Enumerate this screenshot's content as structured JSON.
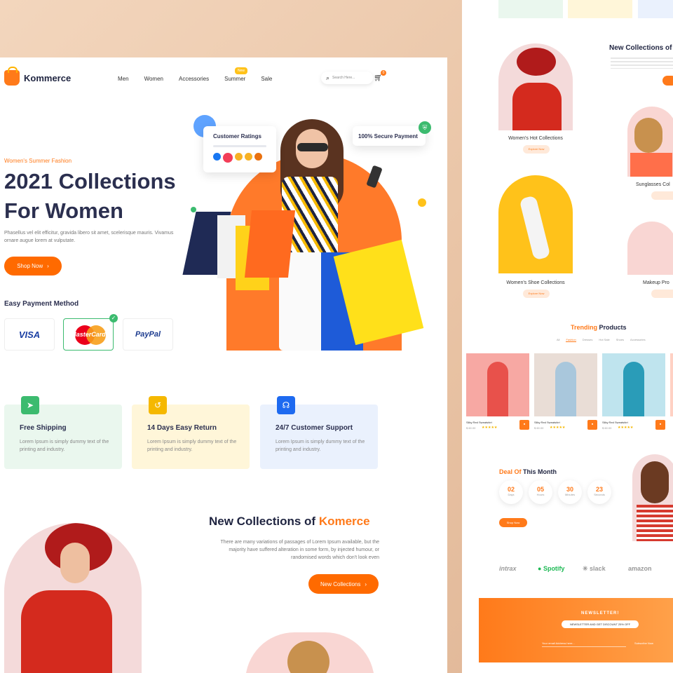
{
  "brand": {
    "name": "Kommerce"
  },
  "nav": {
    "items": [
      "Men",
      "Women",
      "Accessories",
      "Summer",
      "Sale"
    ],
    "badge": "New",
    "search_placeholder": "Search Here..."
  },
  "cart": {
    "count": "0"
  },
  "hero": {
    "subtitle": "Women's Summer Fashion",
    "title": "2021 Collections For Women",
    "text": "Phasellus vel elit efficitur, gravida libero sit amet, scelerisque mauris. Vivamus ornare augue lorem at vulputate.",
    "cta": "Shop Now"
  },
  "float_cards": {
    "ratings": "Customer Ratings",
    "secure": "100% Secure Payment"
  },
  "payment": {
    "title": "Easy Payment Method",
    "methods": [
      "VISA",
      "MasterCard",
      "PayPal"
    ]
  },
  "features": [
    {
      "title": "Free Shipping",
      "text": "Lorem Ipsum is simply dummy text of the printing and industry."
    },
    {
      "title": "14 Days Easy Return",
      "text": "Lorem Ipsum is simply dummy text of the printing and industry."
    },
    {
      "title": "24/7 Customer Support",
      "text": "Lorem Ipsum is simply dummy text of the printing and industry."
    }
  ],
  "collections": {
    "title": "New Collections of",
    "accent": "Komerce",
    "text": "There are many variations of passages of Lorem Ipsum available, but the majority have suffered alteration in some form, by injected humour, or randomised words which don't look even",
    "cta": "New Collections"
  },
  "right": {
    "top_title": "New Collections of",
    "cats": [
      "Women's Hot Collections",
      "Sunglasses Col",
      "Women's Shoe Collections",
      "Makeup Pro"
    ],
    "explore": "Explore Now",
    "trending": {
      "accent": "Trending",
      "rest": "Products",
      "tabs": [
        "All",
        "Fashion",
        "Dresses",
        "Hot Sale",
        "Shoes",
        "Accessories"
      ]
    },
    "products": [
      {
        "name": "Silky Red Sweatshirt",
        "price": "$ 60.00"
      },
      {
        "name": "Silky Red Sweatshirt",
        "price": "$ 60.00"
      },
      {
        "name": "Silky Red Sweatshirt",
        "price": "$ 60.00"
      }
    ],
    "deal": {
      "accent": "Deal Of",
      "rest": "This Month",
      "timer": [
        {
          "v": "02",
          "l": "Days"
        },
        {
          "v": "05",
          "l": "Hours"
        },
        {
          "v": "30",
          "l": "Minutes"
        },
        {
          "v": "23",
          "l": "Seconds"
        }
      ],
      "cta": "Shop Now"
    },
    "brands": [
      "intrax",
      "Spotify",
      "slack",
      "amazon"
    ],
    "newsletter": {
      "title": "NEWSLETTER!",
      "pill": "NEWSLETTER AND GET DISCOUNT 25% OFF",
      "placeholder": "Your email Address here...",
      "subscribe": "Subscribe Now"
    }
  }
}
